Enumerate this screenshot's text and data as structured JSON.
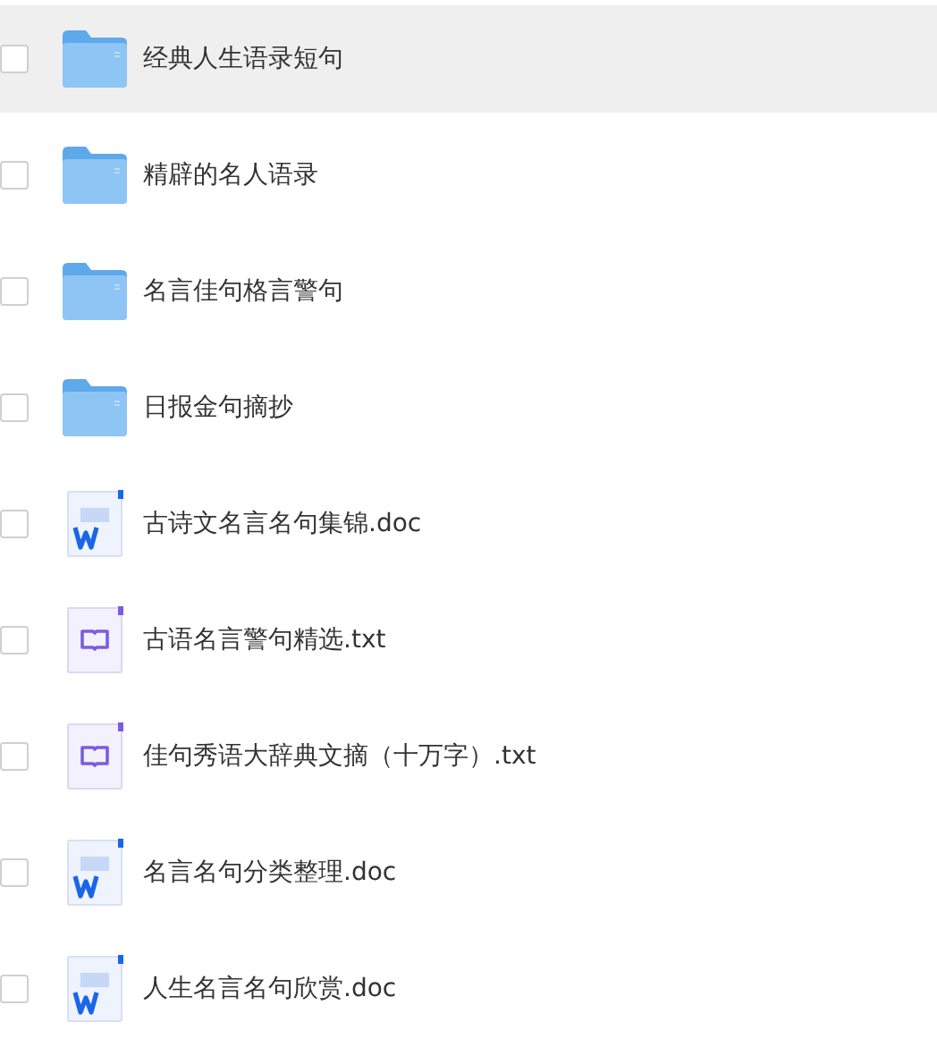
{
  "files": [
    {
      "kind": "folder",
      "name": "经典人生语录短句",
      "checked": false,
      "highlighted": true
    },
    {
      "kind": "folder",
      "name": "精辟的名人语录",
      "checked": false,
      "highlighted": false
    },
    {
      "kind": "folder",
      "name": "名言佳句格言警句",
      "checked": false,
      "highlighted": false
    },
    {
      "kind": "folder",
      "name": "日报金句摘抄",
      "checked": false,
      "highlighted": false
    },
    {
      "kind": "doc",
      "name": "古诗文名言名句集锦.doc",
      "checked": false,
      "highlighted": false
    },
    {
      "kind": "txt",
      "name": "古语名言警句精选.txt",
      "checked": false,
      "highlighted": false
    },
    {
      "kind": "txt",
      "name": "佳句秀语大辞典文摘（十万字）.txt",
      "checked": false,
      "highlighted": false
    },
    {
      "kind": "doc",
      "name": "名言名句分类整理.doc",
      "checked": false,
      "highlighted": false
    },
    {
      "kind": "doc",
      "name": "人生名言名句欣赏.doc",
      "checked": false,
      "highlighted": false
    }
  ]
}
